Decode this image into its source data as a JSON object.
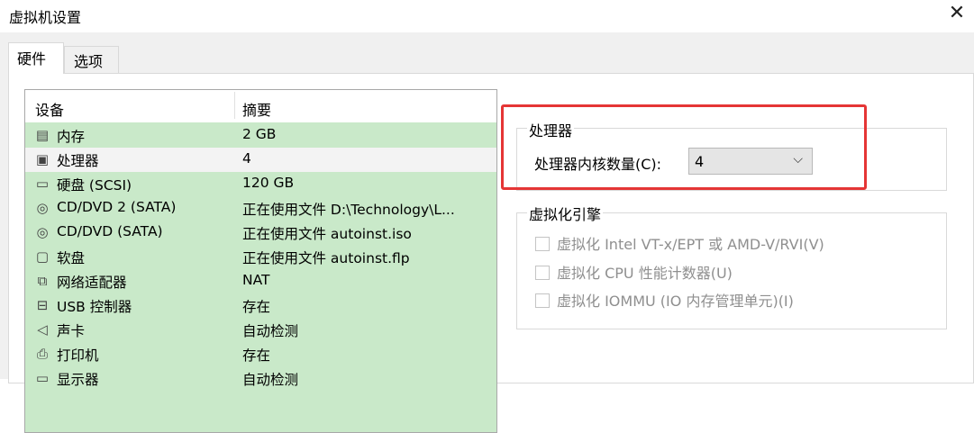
{
  "window": {
    "title": "虚拟机设置",
    "close_glyph": "✕"
  },
  "tabs": [
    {
      "label": "硬件"
    },
    {
      "label": "选项"
    }
  ],
  "device_list": {
    "headers": {
      "device": "设备",
      "summary": "摘要"
    },
    "rows": [
      {
        "icon": "memory-icon",
        "glyph": "▤",
        "name": "内存",
        "summary": "2 GB"
      },
      {
        "icon": "processor-icon",
        "glyph": "▣",
        "name": "处理器",
        "summary": "4"
      },
      {
        "icon": "hard-disk-icon",
        "glyph": "▭",
        "name": "硬盘 (SCSI)",
        "summary": "120 GB"
      },
      {
        "icon": "cd-dvd-icon",
        "glyph": "◎",
        "name": "CD/DVD 2 (SATA)",
        "summary": "正在使用文件 D:\\Technology\\L..."
      },
      {
        "icon": "cd-dvd-icon",
        "glyph": "◎",
        "name": "CD/DVD (SATA)",
        "summary": "正在使用文件 autoinst.iso"
      },
      {
        "icon": "floppy-icon",
        "glyph": "▢",
        "name": "软盘",
        "summary": "正在使用文件 autoinst.flp"
      },
      {
        "icon": "network-adapter-icon",
        "glyph": "⧉",
        "name": "网络适配器",
        "summary": "NAT"
      },
      {
        "icon": "usb-controller-icon",
        "glyph": "⊟",
        "name": "USB 控制器",
        "summary": "存在"
      },
      {
        "icon": "sound-card-icon",
        "glyph": "◁",
        "name": "声卡",
        "summary": "自动检测"
      },
      {
        "icon": "printer-icon",
        "glyph": "⎙",
        "name": "打印机",
        "summary": "存在"
      },
      {
        "icon": "display-icon",
        "glyph": "▭",
        "name": "显示器",
        "summary": "自动检测"
      }
    ]
  },
  "processor": {
    "group_title": "处理器",
    "cores_label": "处理器内核数量(C):",
    "cores_value": "4",
    "arrow_glyph": "⌵"
  },
  "virtualization": {
    "group_title": "虚拟化引擎",
    "options": [
      {
        "label": "虚拟化 Intel VT-x/EPT 或 AMD-V/RVI(V)",
        "checked": false,
        "enabled": false
      },
      {
        "label": "虚拟化 CPU 性能计数器(U)",
        "checked": false,
        "enabled": false
      },
      {
        "label": "虚拟化 IOMMU (IO 内存管理单元)(I)",
        "checked": false,
        "enabled": false
      }
    ]
  },
  "colors": {
    "row_bg": "#c9e9c9",
    "selected_row": "#f3f3f3",
    "highlight": "#e53535"
  }
}
